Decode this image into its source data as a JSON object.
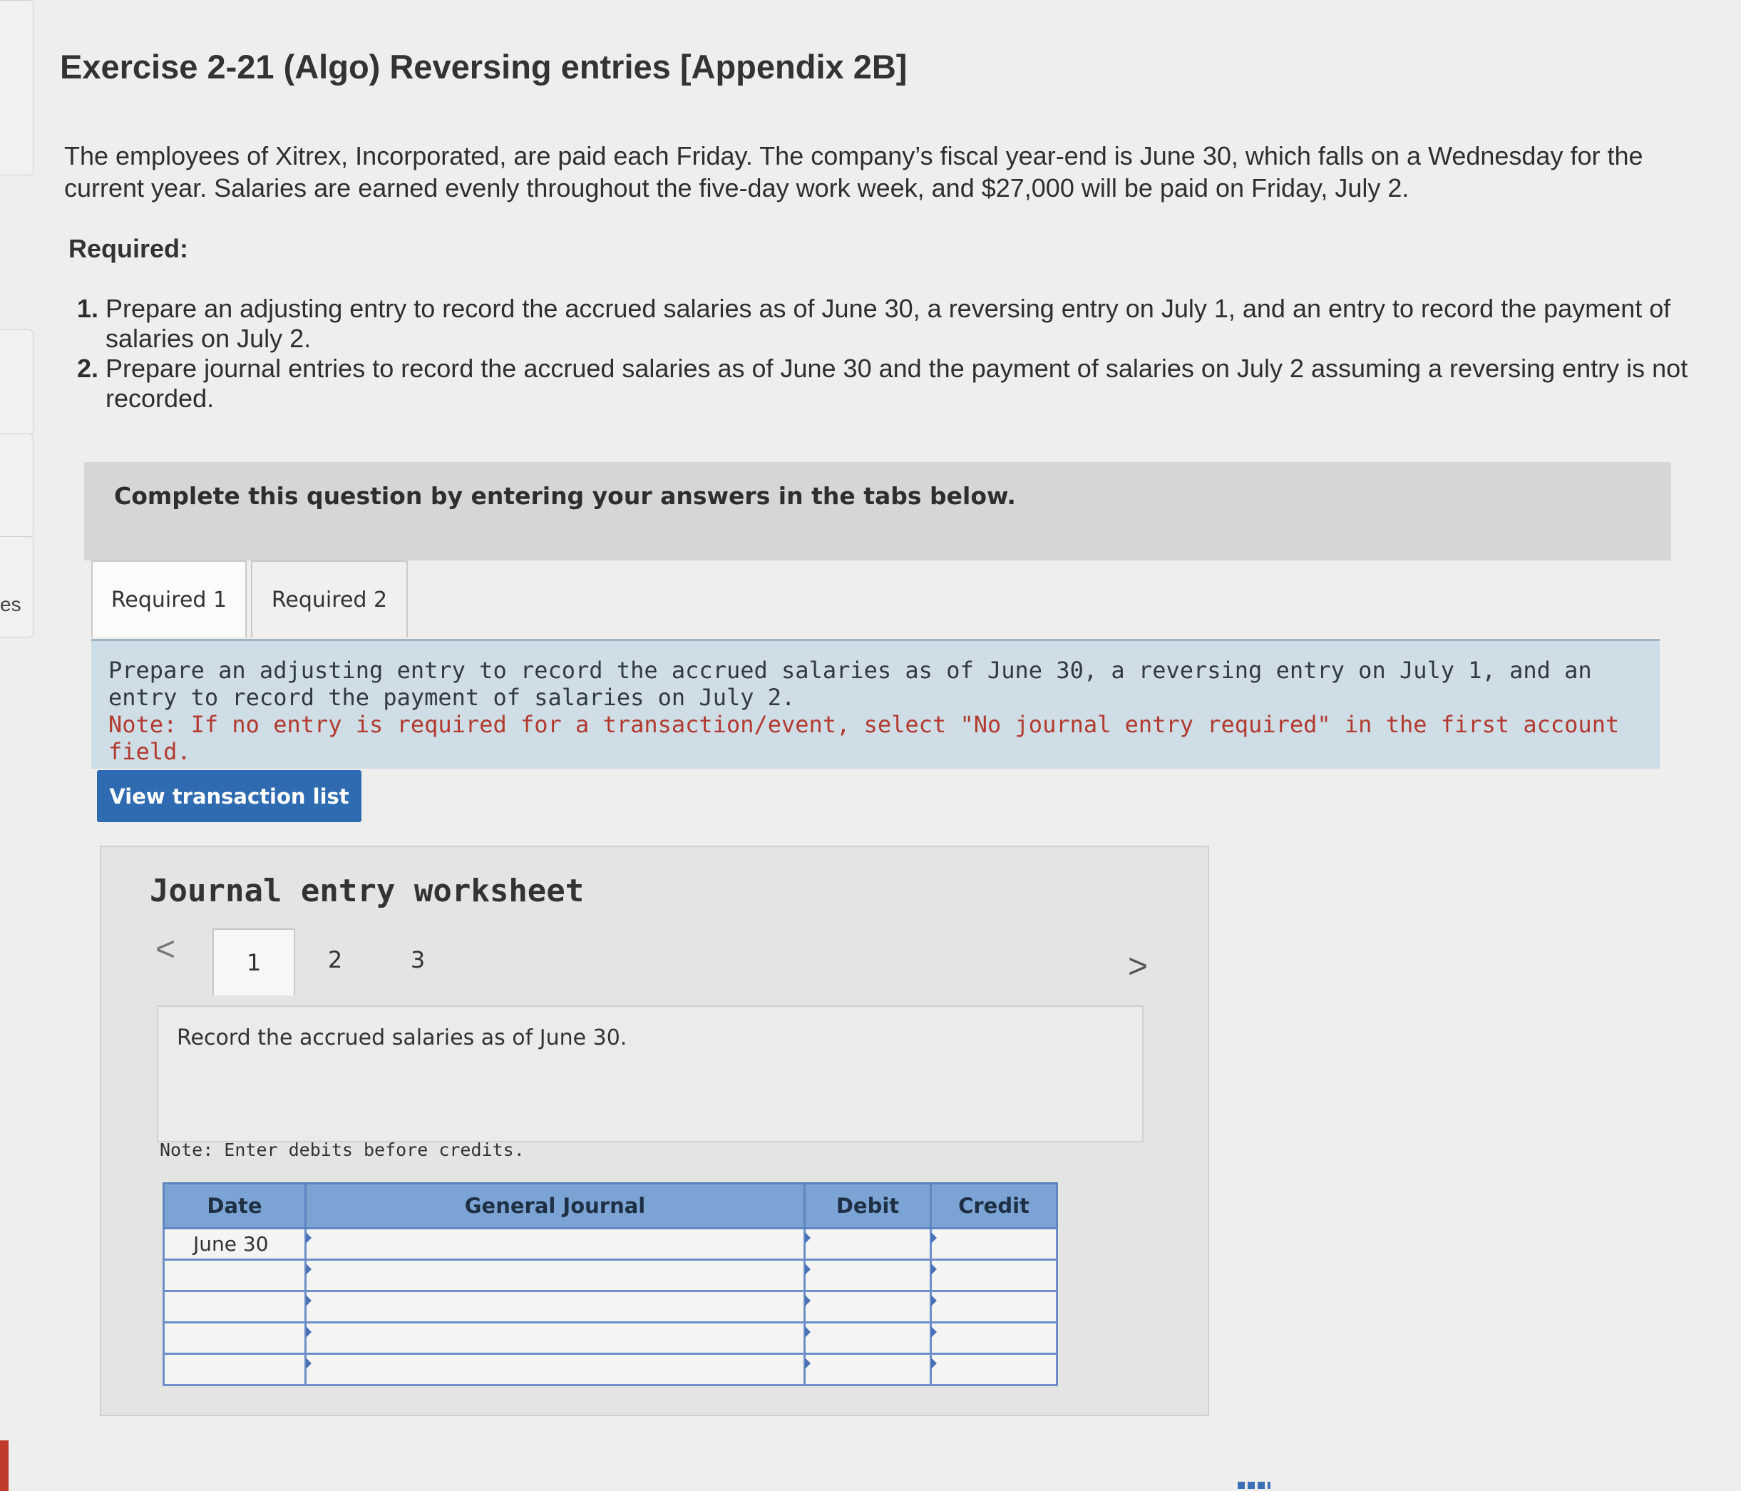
{
  "left_fragment": {
    "text": "es"
  },
  "title": "Exercise 2-21 (Algo) Reversing entries [Appendix 2B]",
  "intro": "The employees of Xitrex, Incorporated, are paid each Friday. The company’s fiscal year-end is June 30, which falls on a Wednesday for the current year. Salaries are earned evenly throughout the five-day work week, and $27,000 will be paid on Friday, July 2.",
  "required_heading": "Required:",
  "requirements": [
    "Prepare an adjusting entry to record the accrued salaries as of June 30, a reversing entry on July 1, and an entry to record the payment of salaries on July 2.",
    "Prepare journal entries to record the accrued salaries as of June 30 and the payment of salaries on July 2 assuming a reversing entry is not recorded."
  ],
  "banner": "Complete this question by entering your answers in the tabs below.",
  "tabs": [
    "Required 1",
    "Required 2"
  ],
  "instruction": {
    "text": "Prepare an adjusting entry to record the accrued salaries as of June 30, a reversing entry on July 1, and an entry to record the payment of salaries on July 2.",
    "note": "Note: If no entry is required for a transaction/event, select \"No journal entry required\" in the first account field."
  },
  "view_button": "View transaction list",
  "worksheet": {
    "title": "Journal entry worksheet",
    "prev_icon": "<",
    "next_icon": ">",
    "pages": [
      "1",
      "2",
      "3"
    ],
    "description": "Record the accrued salaries as of June 30.",
    "note": "Note: Enter debits before credits.",
    "columns": [
      "Date",
      "General Journal",
      "Debit",
      "Credit"
    ],
    "rows": [
      {
        "date": "June 30",
        "account": "",
        "debit": "",
        "credit": ""
      },
      {
        "date": "",
        "account": "",
        "debit": "",
        "credit": ""
      },
      {
        "date": "",
        "account": "",
        "debit": "",
        "credit": ""
      },
      {
        "date": "",
        "account": "",
        "debit": "",
        "credit": ""
      },
      {
        "date": "",
        "account": "",
        "debit": "",
        "credit": ""
      }
    ]
  },
  "colors": {
    "button": "#2e6bb0",
    "table_header": "#7ba4d4",
    "note_red": "#b23a2e",
    "instruction_bg": "#cfdde6"
  }
}
